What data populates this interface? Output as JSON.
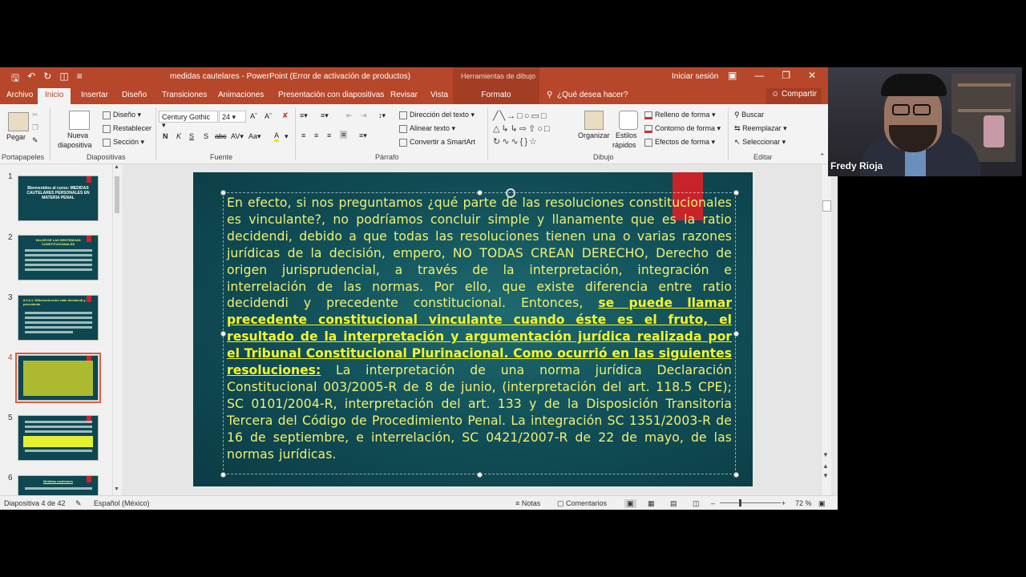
{
  "window": {
    "title": "medidas cautelares - PowerPoint (Error de activación de productos)",
    "contextual_group": "Herramientas de dibujo",
    "sign_in": "Iniciar sesión"
  },
  "tabs": [
    "Archivo",
    "Inicio",
    "Insertar",
    "Diseño",
    "Transiciones",
    "Animaciones",
    "Presentación con diapositivas",
    "Revisar",
    "Vista"
  ],
  "contextual_tab": "Formato",
  "tell_me": "¿Qué desea hacer?",
  "share": "Compartir",
  "ribbon": {
    "portapapeles": {
      "label": "Portapapeles",
      "paste": "Pegar"
    },
    "diapositivas": {
      "label": "Diapositivas",
      "new_slide_1": "Nueva",
      "new_slide_2": "diapositiva",
      "design": "Diseño",
      "reset": "Restablecer",
      "section": "Sección"
    },
    "fuente": {
      "label": "Fuente",
      "font_name": "Century Gothic",
      "font_size": "24"
    },
    "parrafo": {
      "label": "Párrafo",
      "text_direction": "Dirección del texto",
      "align_text": "Alinear texto",
      "smartart": "Convertir a SmartArt"
    },
    "dibujo": {
      "label": "Dibujo",
      "arrange": "Organizar",
      "quick_styles_1": "Estilos",
      "quick_styles_2": "rápidos",
      "shape_fill": "Relleno de forma",
      "shape_outline": "Contorno de forma",
      "shape_effects": "Efectos de forma"
    },
    "editar": {
      "label": "Editar",
      "find": "Buscar",
      "replace": "Reemplazar",
      "select": "Seleccionar"
    }
  },
  "slides": [
    {
      "number": "1",
      "title": "Bienvenidos al curso: MEDIDAS CAUTELARES PERSONALES EN MATERIA PENAL"
    },
    {
      "number": "2",
      "title": "VALOR DE LAS SENTENCIAS CONSTITUCIONALES"
    },
    {
      "number": "3",
      "title": "8.3.3.1. Diferencia entre ratio decidendi y precedente"
    },
    {
      "number": "4",
      "title": ""
    },
    {
      "number": "5",
      "title": ""
    },
    {
      "number": "6",
      "title": "Medidas cautelares"
    }
  ],
  "selected_slide": 4,
  "slide_content": {
    "text_part1": "En efecto, si nos preguntamos ¿qué parte de las resoluciones constitucionales es vinculante?, no podríamos concluir simple y llanamente que es la ratio decidendi, debido a que todas las resoluciones tienen una o varias razones jurídicas de la decisión, empero, NO TODAS CREAN DERECHO, Derecho de origen jurisprudencial, a través de la interpretación, integración e interrelación de las normas. Por ello, que existe diferencia entre ratio decidendi y precedente constitucional. Entonces, ",
    "text_bold": "se puede llamar precedente constitucional vinculante cuando éste es el fruto, el resultado de la interpretación y argumentación jurídica realizada por el Tribunal Constitucional Plurinacional. Como ocurrió en las siguientes resoluciones:",
    "text_part2": " La interpretación de una norma jurídica Declaración Constitucional 003/2005-R de 8 de junio, (interpretación del art. 118.5 CPE); SC 0101/2004-R, interpretación del art. 133 y de la Disposición Transitoria Tercera del Código de Procedimiento Penal. La integración SC 1351/2003-R de 16 de septiembre, e interrelación, SC 0421/2007-R de 22 de mayo, de las normas jurídicas."
  },
  "status": {
    "slide_info": "Diapositiva 4 de 42",
    "language": "Español (México)",
    "notes": "Notas",
    "comments": "Comentarios",
    "zoom": "72 %"
  },
  "webcam": {
    "name": "Fredy Rioja"
  },
  "colors": {
    "accent": "#b7472a",
    "slide_bg": "#104c55",
    "slide_text": "#f1f171",
    "slide_bold": "#f4f52a"
  }
}
